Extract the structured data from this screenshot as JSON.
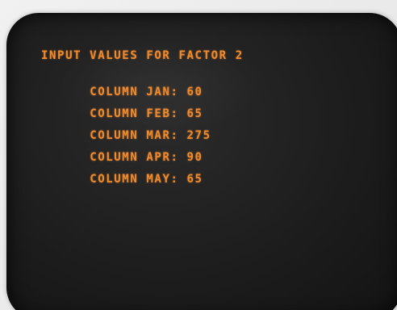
{
  "screen": {
    "heading": "INPUT VALUES FOR FACTOR 2",
    "rows": [
      {
        "label": "COLUMN JAN:",
        "value": "60"
      },
      {
        "label": "COLUMN FEB:",
        "value": "65"
      },
      {
        "label": "COLUMN MAR:",
        "value": "275"
      },
      {
        "label": "COLUMN APR:",
        "value": "90"
      },
      {
        "label": "COLUMN MAY:",
        "value": "65"
      }
    ]
  },
  "colors": {
    "text": "#f08a2c",
    "screen": "#1d1d1d",
    "background": "#ececec"
  }
}
